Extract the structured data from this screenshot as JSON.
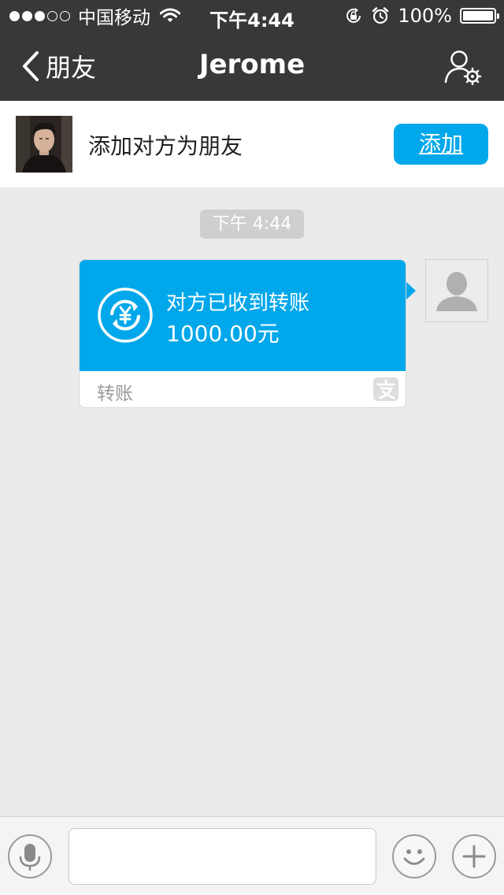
{
  "status_bar": {
    "carrier": "中国移动",
    "time": "下午4:44",
    "battery": "100%",
    "signal_bars": 3
  },
  "nav": {
    "back_label": "朋友",
    "title": "Jerome",
    "settings_icon": "person-settings-icon"
  },
  "banner": {
    "text": "添加对方为朋友",
    "add_button": "添加"
  },
  "chat": {
    "timestamp": "下午 4:44",
    "transfer": {
      "status": "对方已收到转账",
      "amount": "1000.00元",
      "footer_label": "转账",
      "icon": "yuan-refresh-icon",
      "badge_icon": "alipay-icon"
    }
  },
  "input_bar": {
    "message_value": "",
    "voice_icon": "microphone-icon",
    "emoji_icon": "smiley-icon",
    "more_icon": "plus-icon"
  },
  "colors": {
    "header": "#383838",
    "accent": "#00a7ea",
    "chat_background": "#ebebeb"
  }
}
